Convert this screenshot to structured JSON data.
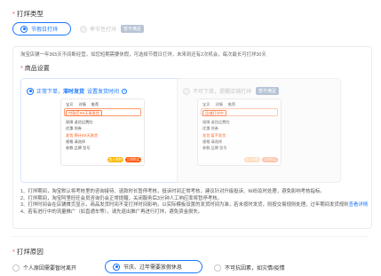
{
  "section1": {
    "title": "打烊类型",
    "opt1": "节假日打烊",
    "opt2": "季节性打烊",
    "opt2_badge": "暂不满足"
  },
  "description": "淘宝店铺一年365天不间断经营，如您短期需要休假，可选择节假日打烊，未来到还有2次机会，每次最长可打烊30天",
  "goods": {
    "title": "商品设置",
    "card_a": {
      "label": "正常下单，",
      "label_bold": "滞时发货",
      "link": "设置发货时间",
      "help": "?"
    },
    "card_b": {
      "label": "不可下单，提醒店铺打烊",
      "badge": "暂不满足"
    }
  },
  "phone_a": {
    "tabs": [
      "宝贝",
      "详情",
      "推荐"
    ],
    "name": "付款后XX天再发货",
    "guarantee": "保障 退货运费险",
    "coupon": "优惠 领券",
    "rows": [
      "发货 预计XX天发货",
      "规格 请选择",
      "参数 品牌 型号"
    ],
    "btn1": "加入购物车",
    "btn2": "立即购买"
  },
  "phone_b": {
    "tabs": [
      "宝贝",
      "详情",
      "推荐"
    ],
    "name": "店铺打烊中",
    "guarantee": "保障 退货运费险",
    "coupon": "优惠 领券",
    "rows": [
      "发货 暂不发货",
      "规格 请选择",
      "参数 品牌 型号"
    ],
    "btn1": "加入购物车",
    "btn2": "立即购买"
  },
  "notes": {
    "n1": "1、打烊期间，淘宝默认将考核里的咨询接待、退款时长暂停考核，投诉时间正常考核，建议针对升级投诉、纠纷及时处理，避免影响考核指标。",
    "n2": "2、打烊期间，淘宝阿里旺旺会员咨询仍会正常提醒，关闭服务后3分钟人工响应率将暂停考核。",
    "n3a": "3、打烊时间会在店铺首页显示，商品发货时间不变打烊时间影响，以实际模板设置的发货时间为准，若未按时发货，则按交易规则处理，过年期间发货规则",
    "n3_link": "查看详情",
    "n4": "4、若有进行中的流量推广（如直通车等），请先退出推广再进行打烊，避免资金损失。"
  },
  "section2": {
    "title": "打烊原因",
    "opt1": "个人原因需要暂时离开",
    "opt2": "节庆、过年需要放假休息",
    "opt3": "不可抗因素，如灾情/疫情"
  },
  "colors": {
    "accent": "#1677ff",
    "required": "#ff4d4f",
    "orange": "#ff5000"
  }
}
